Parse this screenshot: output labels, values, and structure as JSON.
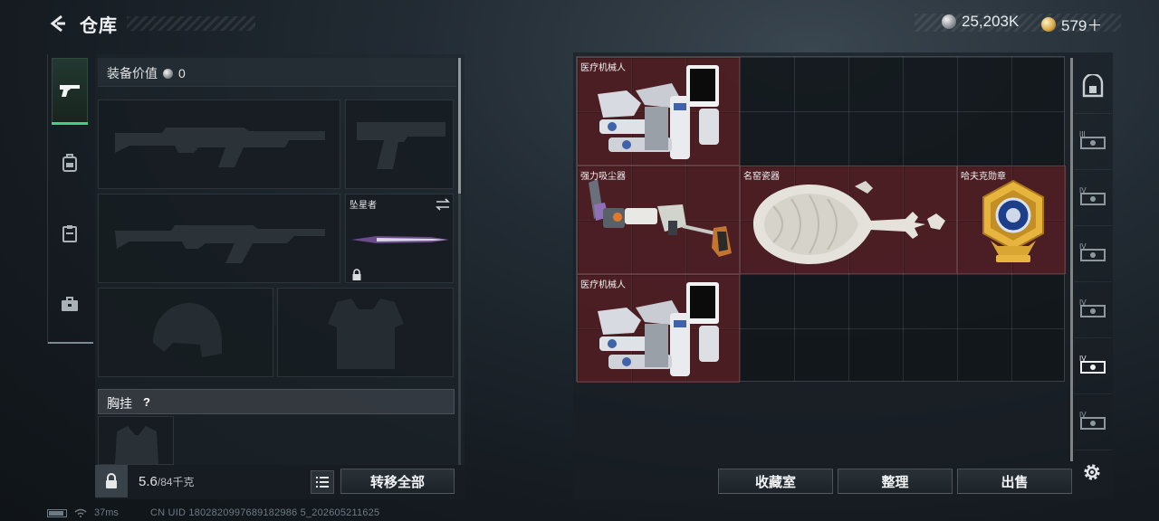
{
  "header": {
    "title": "仓库",
    "currency_silver": "25,203K",
    "currency_gold": "579＋"
  },
  "sidebar": {
    "tabs": [
      {
        "icon": "pistol-icon",
        "active": true
      },
      {
        "icon": "backpack-icon",
        "active": false
      },
      {
        "icon": "clipboard-icon",
        "active": false
      },
      {
        "icon": "briefcase-icon",
        "active": false
      }
    ]
  },
  "equipment": {
    "value_label": "装备价值",
    "value": "0",
    "melee_label": "坠星者",
    "chest_label": "胸挂",
    "help": "?"
  },
  "bottom_left": {
    "weight_current": "5.6",
    "weight_max": "/84千克",
    "transfer_all": "转移全部"
  },
  "grid_items": [
    {
      "name": "医疗机械人",
      "kind": "medical-robot"
    },
    {
      "name": "强力吸尘器",
      "kind": "vacuum"
    },
    {
      "name": "名窑瓷器",
      "kind": "porcelain"
    },
    {
      "name": "哈夫克勋章",
      "kind": "medal"
    },
    {
      "name": "医疗机械人",
      "kind": "medical-robot"
    }
  ],
  "rail": {
    "levels": [
      "",
      "III",
      "IV",
      "IV",
      "IV",
      "IV",
      "IV"
    ]
  },
  "bottom_right": {
    "collection": "收藏室",
    "organize": "整理",
    "sell": "出售"
  },
  "status": {
    "ping": "37ms",
    "uid": "CN UID 1802820997689182986 5_202605211625"
  },
  "colors": {
    "item_bg": "#6e2228",
    "accent_green": "#3fd08a"
  }
}
